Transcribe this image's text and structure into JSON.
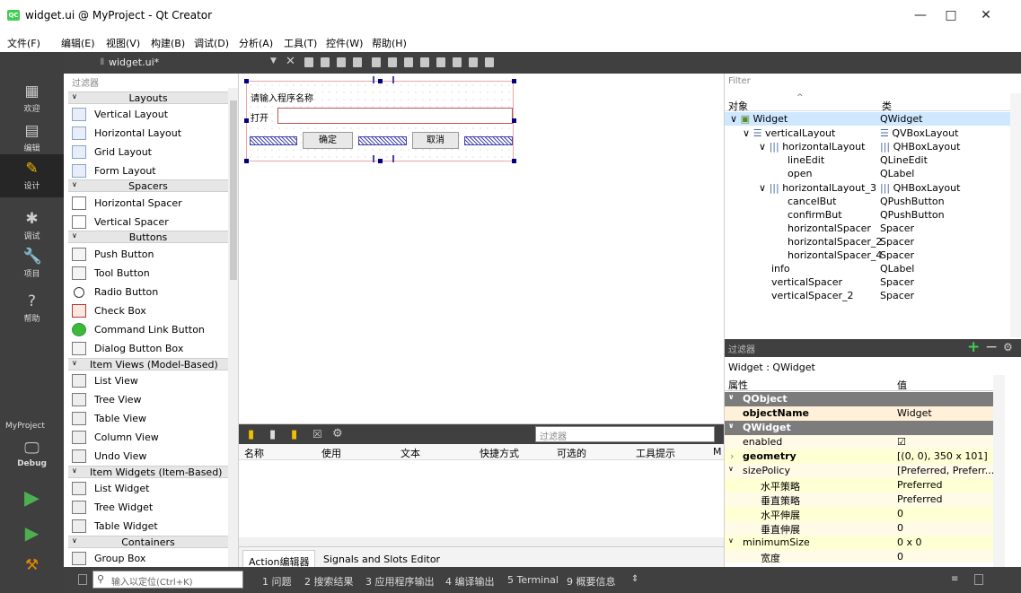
{
  "window": {
    "title": "widget.ui @ MyProject - Qt Creator",
    "app_icon": "QC",
    "controls": [
      "—",
      "□",
      "✕"
    ]
  },
  "menu": [
    "文件(F)",
    "编辑(E)",
    "视图(V)",
    "构建(B)",
    "调试(D)",
    "分析(A)",
    "工具(T)",
    "控件(W)",
    "帮助(H)"
  ],
  "modes": {
    "welcome": "欢迎",
    "edit": "编辑",
    "design": "设计",
    "debug": "调试",
    "projects": "项目",
    "help": "帮助",
    "project_name": "MyProject",
    "kit": "Debug"
  },
  "editor": {
    "file_name": "widget.ui*"
  },
  "widget_box": {
    "filter_placeholder": "过滤器",
    "layouts": {
      "title": "Layouts",
      "items": [
        "Vertical Layout",
        "Horizontal Layout",
        "Grid Layout",
        "Form Layout"
      ]
    },
    "spacers": {
      "title": "Spacers",
      "items": [
        "Horizontal Spacer",
        "Vertical Spacer"
      ]
    },
    "buttons": {
      "title": "Buttons",
      "items": [
        "Push Button",
        "Tool Button",
        "Radio Button",
        "Check Box",
        "Command Link Button",
        "Dialog Button Box"
      ]
    },
    "item_views": {
      "title": "Item Views (Model-Based)",
      "items": [
        "List View",
        "Tree View",
        "Table View",
        "Column View",
        "Undo View"
      ]
    },
    "item_widgets": {
      "title": "Item Widgets (Item-Based)",
      "items": [
        "List Widget",
        "Tree Widget",
        "Table Widget"
      ]
    },
    "containers": {
      "title": "Containers",
      "items": [
        "Group Box"
      ]
    }
  },
  "form": {
    "info_label": "请输入程序名称",
    "open_label": "打开",
    "confirm": "确定",
    "cancel": "取消"
  },
  "action_editor": {
    "filter_placeholder": "过滤器",
    "columns": [
      "名称",
      "使用",
      "文本",
      "快捷方式",
      "可选的",
      "工具提示",
      "M"
    ],
    "tabs": [
      "Action编辑器",
      "Signals and Slots Editor"
    ]
  },
  "object_inspector": {
    "filter_placeholder": "Filter",
    "col_object": "对象",
    "col_class": "类",
    "rows": [
      {
        "name": "Widget",
        "cls": "QWidget"
      },
      {
        "name": "verticalLayout",
        "cls": "QVBoxLayout"
      },
      {
        "name": "horizontalLayout",
        "cls": "QHBoxLayout"
      },
      {
        "name": "lineEdit",
        "cls": "QLineEdit"
      },
      {
        "name": "open",
        "cls": "QLabel"
      },
      {
        "name": "horizontalLayout_3",
        "cls": "QHBoxLayout"
      },
      {
        "name": "cancelBut",
        "cls": "QPushButton"
      },
      {
        "name": "confirmBut",
        "cls": "QPushButton"
      },
      {
        "name": "horizontalSpacer",
        "cls": "Spacer"
      },
      {
        "name": "horizontalSpacer_2",
        "cls": "Spacer"
      },
      {
        "name": "horizontalSpacer_4",
        "cls": "Spacer"
      },
      {
        "name": "info",
        "cls": "QLabel"
      },
      {
        "name": "verticalSpacer",
        "cls": "Spacer"
      },
      {
        "name": "verticalSpacer_2",
        "cls": "Spacer"
      }
    ]
  },
  "property_editor": {
    "filter_placeholder": "过滤器",
    "title": "Widget : QWidget",
    "col_property": "属性",
    "col_value": "值",
    "rows": [
      {
        "k": "QObject",
        "v": ""
      },
      {
        "k": "objectName",
        "v": "Widget"
      },
      {
        "k": "QWidget",
        "v": ""
      },
      {
        "k": "enabled",
        "v": "☑"
      },
      {
        "k": "geometry",
        "v": "[(0, 0), 350 x 101]"
      },
      {
        "k": "sizePolicy",
        "v": "[Preferred, Preferr..."
      },
      {
        "k": "水平策略",
        "v": "Preferred"
      },
      {
        "k": "垂直策略",
        "v": "Preferred"
      },
      {
        "k": "水平伸展",
        "v": "0"
      },
      {
        "k": "垂直伸展",
        "v": "0"
      },
      {
        "k": "minimumSize",
        "v": "0 x 0"
      },
      {
        "k": "宽度",
        "v": "0"
      }
    ]
  },
  "statusbar": {
    "locator_placeholder": "输入以定位(Ctrl+K)",
    "items": [
      "1 问题",
      "2 搜索结果",
      "3 应用程序输出",
      "4 编译输出",
      "5 Terminal",
      "9 概要信息"
    ]
  }
}
